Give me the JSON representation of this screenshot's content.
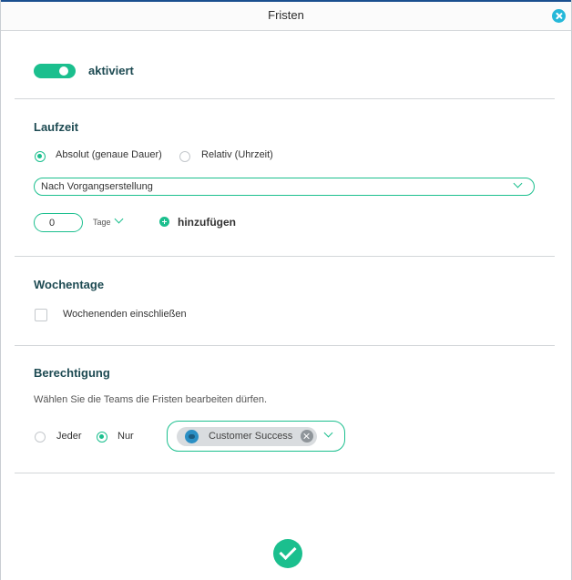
{
  "window": {
    "title": "Fristen"
  },
  "status": {
    "toggle_label": "aktiviert",
    "enabled": true
  },
  "laufzeit": {
    "title": "Laufzeit",
    "options": [
      {
        "label": "Absolut (genaue Dauer)",
        "selected": true
      },
      {
        "label": "Relativ (Uhrzeit)",
        "selected": false
      }
    ],
    "reference_select": "Nach Vorgangserstellung",
    "amount": "0",
    "unit": "Tage",
    "add_label": "hinzufügen"
  },
  "wochentage": {
    "title": "Wochentage",
    "weekend_label": "Wochenenden einschließen",
    "weekend_checked": false
  },
  "berechtigung": {
    "title": "Berechtigung",
    "description": "Wählen Sie die Teams die Fristen bearbeiten dürfen.",
    "options": [
      {
        "label": "Jeder",
        "selected": false
      },
      {
        "label": "Nur",
        "selected": true
      }
    ],
    "teams": [
      "Customer Success"
    ]
  },
  "colors": {
    "accent": "#1bbf8e",
    "title_bar_border": "#1a4f8f",
    "close": "#25b8d9",
    "heading": "#1d4a52"
  },
  "icons": {
    "close": "close-icon",
    "chevron": "chevron-down-icon",
    "add": "plus-circle-icon",
    "team": "team-avatar-icon",
    "remove": "remove-chip-icon",
    "confirm": "checkmark-icon"
  }
}
